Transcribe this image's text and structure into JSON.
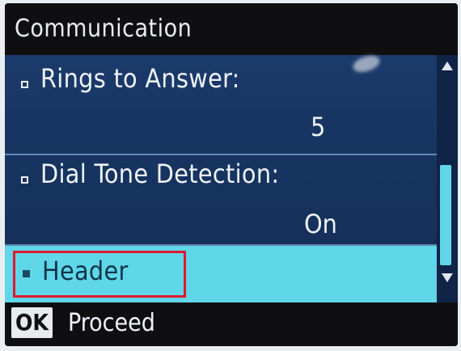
{
  "title": "Communication",
  "items": [
    {
      "label": "Rings to Answer:",
      "value": "5"
    },
    {
      "label": "Dial Tone Detection:",
      "value": "On"
    },
    {
      "label": "Header",
      "value": ""
    }
  ],
  "footer": {
    "ok_label": "OK",
    "action_label": "Proceed"
  },
  "selected_item": "Header",
  "colors": {
    "selection": "#5fd7e8",
    "highlight_box": "#e0182b",
    "background": "#183563"
  },
  "icons": [
    "scroll-up-arrow-icon",
    "scroll-down-arrow-icon",
    "bullet-icon"
  ]
}
